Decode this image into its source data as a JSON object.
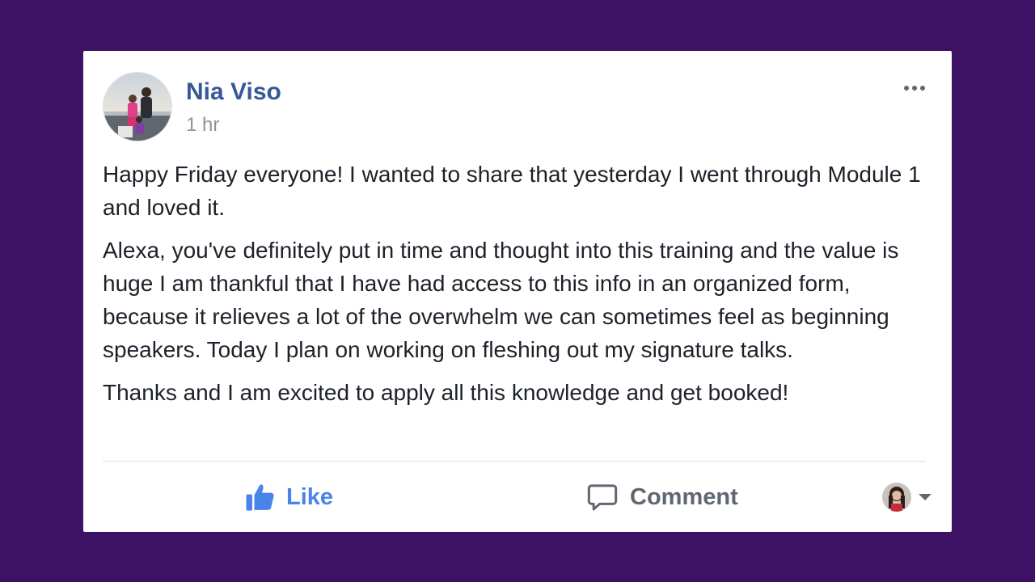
{
  "post": {
    "author": "Nia Viso",
    "time": "1 hr",
    "paragraphs": [
      "Happy Friday everyone! I wanted to share that yesterday I went through Module 1 and loved it.",
      "Alexa, you've definitely put in time and thought into this training and the value is huge I am thankful that I have had access to this info in an organized form, because it relieves a lot of the overwhelm we can sometimes feel as beginning speakers. Today I plan on working on fleshing out my signature talks.",
      "Thanks and I am excited to apply all this knowledge and get booked!"
    ]
  },
  "actions": {
    "like_label": "Like",
    "comment_label": "Comment"
  },
  "icons": {
    "more": "more-options-icon",
    "like": "thumbs-up-icon",
    "comment": "speech-bubble-icon",
    "dropdown": "caret-down-icon"
  },
  "colors": {
    "background": "#3d1163",
    "card": "#ffffff",
    "author_link": "#385898",
    "like_active": "#4b84e8",
    "muted_text": "#606770",
    "timestamp": "#8d949e",
    "body_text": "#1d2129"
  }
}
